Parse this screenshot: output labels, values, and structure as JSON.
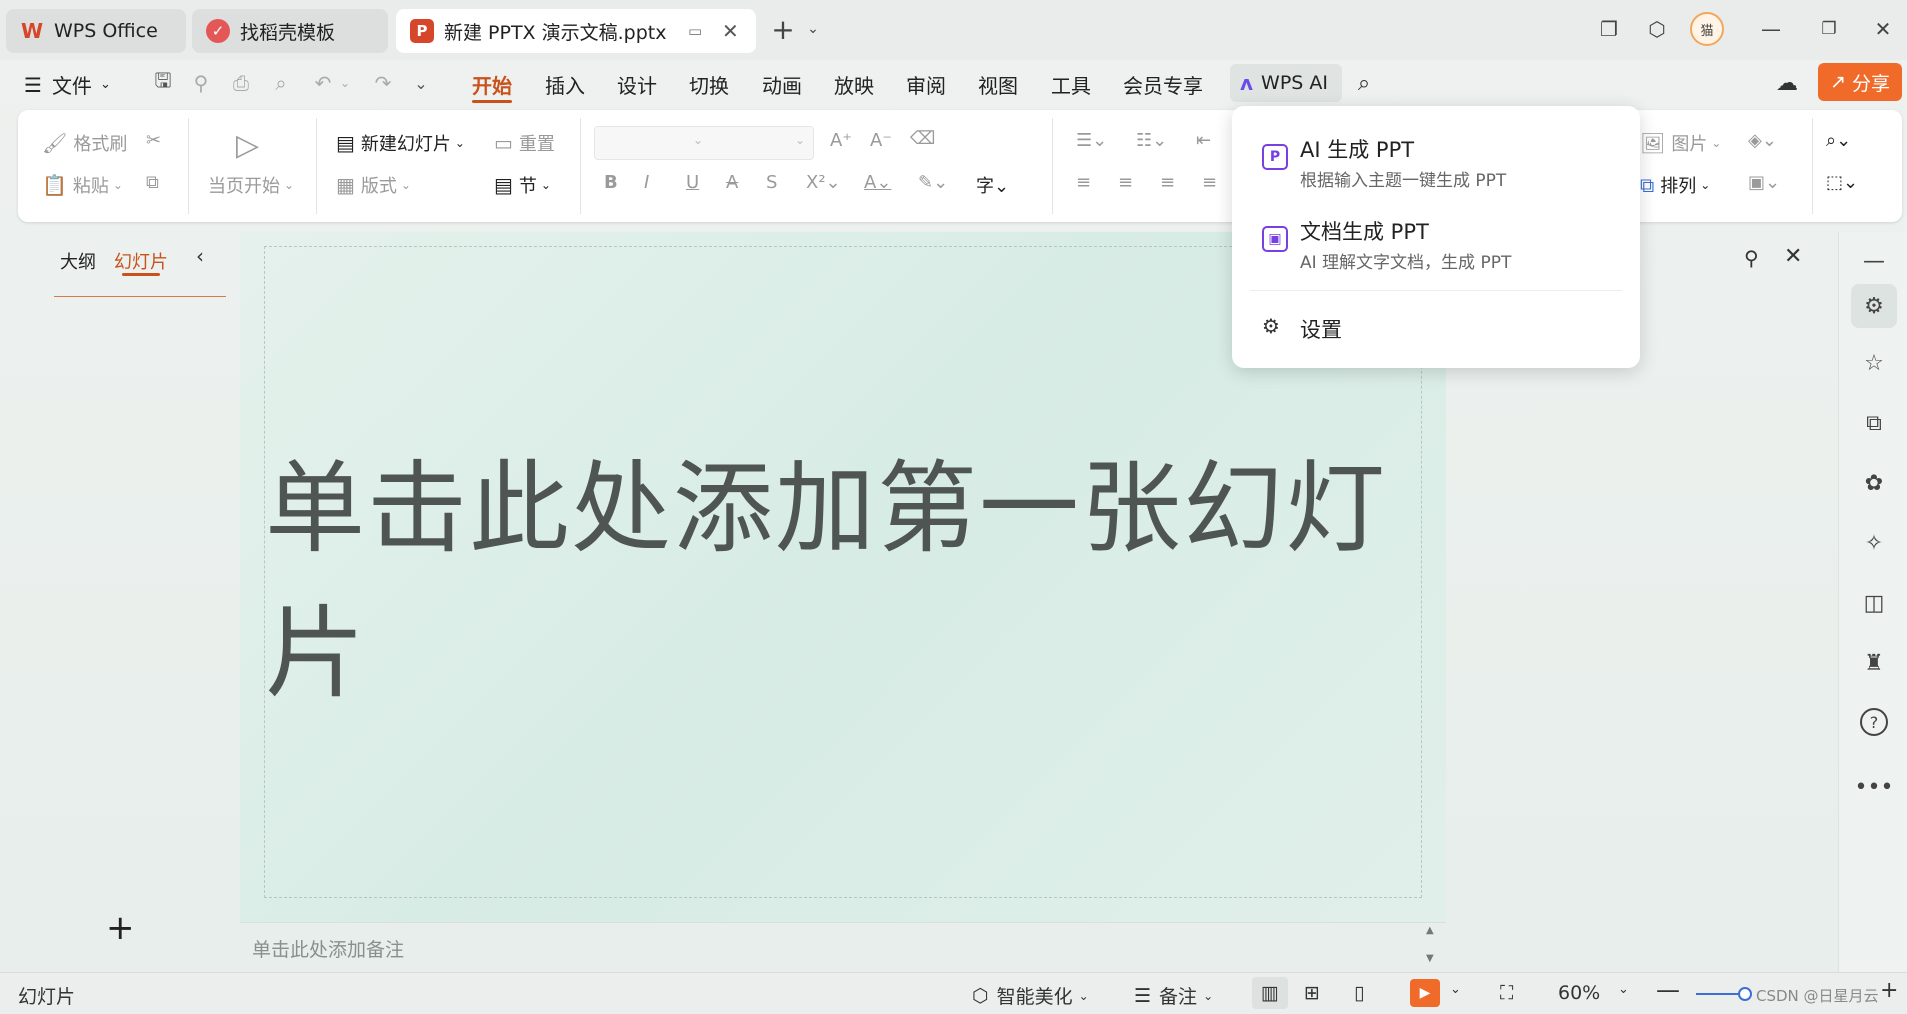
{
  "tabs": [
    {
      "label": "WPS Office",
      "icon": "wps-logo-icon"
    },
    {
      "label": "找稻壳模板",
      "icon": "docer-icon"
    },
    {
      "label": "新建 PPTX 演示文稿.pptx",
      "icon": "ppt-file-icon"
    }
  ],
  "user_avatar_text": "猫",
  "menu": {
    "file": "文件",
    "items": [
      "开始",
      "插入",
      "设计",
      "切换",
      "动画",
      "放映",
      "审阅",
      "视图",
      "工具",
      "会员专享"
    ],
    "active_index": 0,
    "wps_ai": "WPS AI",
    "share": "分享"
  },
  "ribbon": {
    "format_painter": "格式刷",
    "paste": "粘贴",
    "play_from_current": "当页开始",
    "new_slide": "新建幻灯片",
    "reset": "重置",
    "layout": "版式",
    "section": "节",
    "picture": "图片",
    "arrange": "排列"
  },
  "left_panel": {
    "tab_outline": "大纲",
    "tab_slides": "幻灯片"
  },
  "slide": {
    "placeholder": "单击此处添加第一张幻灯片"
  },
  "notes": {
    "placeholder": "单击此处添加备注"
  },
  "ai_dropdown": {
    "items": [
      {
        "title": "AI 生成 PPT",
        "subtitle": "根据输入主题一键生成 PPT",
        "icon": "ai-generate-ppt-icon"
      },
      {
        "title": "文档生成 PPT",
        "subtitle": "AI 理解文字文档，生成 PPT",
        "icon": "doc-to-ppt-icon"
      }
    ],
    "settings": "设置"
  },
  "statusbar": {
    "left": "幻灯片",
    "beautify": "智能美化",
    "notes": "备注",
    "zoom": "60%",
    "watermark": "CSDN @日星月云"
  },
  "colors": {
    "accent": "#c9521c",
    "share_bg": "#f06a2a",
    "ai_purple": "#7a3fe0",
    "ppt_red": "#d6462b"
  }
}
